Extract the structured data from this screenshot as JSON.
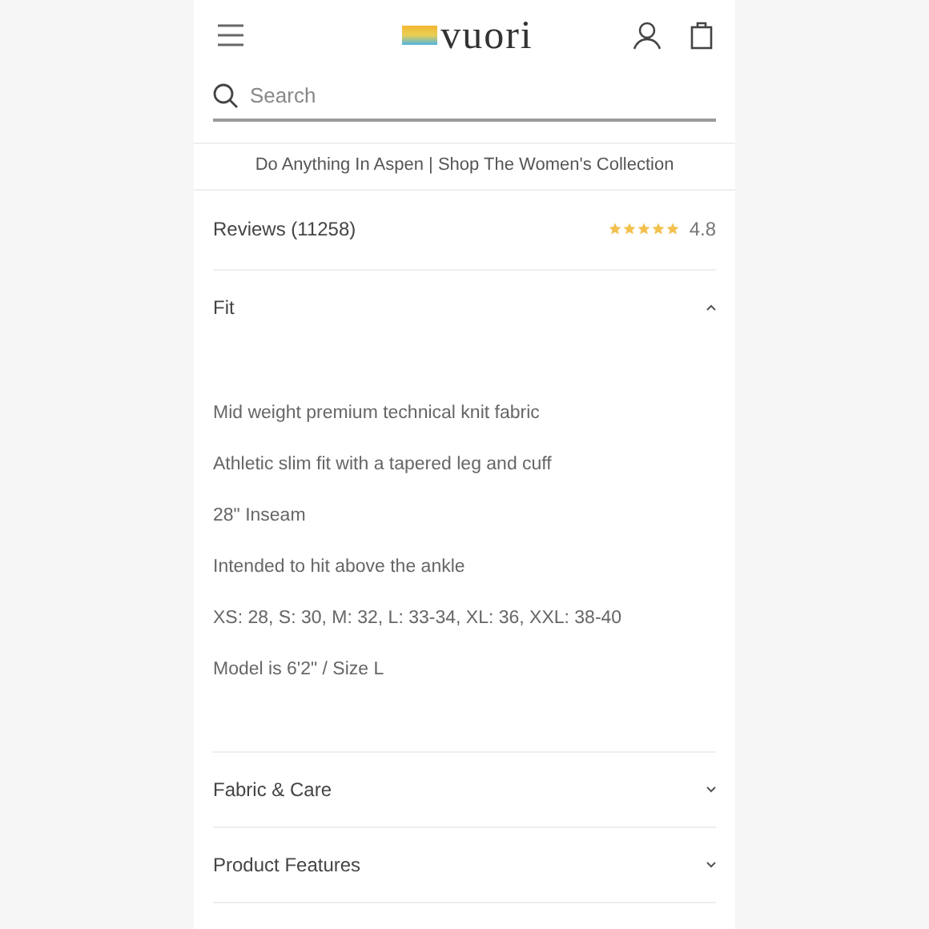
{
  "header": {
    "logo": "vuori"
  },
  "search": {
    "placeholder": "Search"
  },
  "banner": "Do Anything In Aspen | Shop The Women's Collection",
  "reviews": {
    "label": "Reviews (11258)",
    "stars": 5,
    "rating": "4.8"
  },
  "sections": [
    {
      "title": "Fit",
      "expanded": true,
      "lines": [
        "Mid weight premium technical knit fabric",
        "Athletic slim fit with a tapered leg and cuff",
        "28\" Inseam",
        "Intended to hit above the ankle",
        "XS: 28, S: 30, M: 32, L: 33-34, XL: 36, XXL: 38-40",
        "Model is 6'2\" / Size L"
      ]
    },
    {
      "title": "Fabric & Care",
      "expanded": false
    },
    {
      "title": "Product Features",
      "expanded": false
    }
  ]
}
